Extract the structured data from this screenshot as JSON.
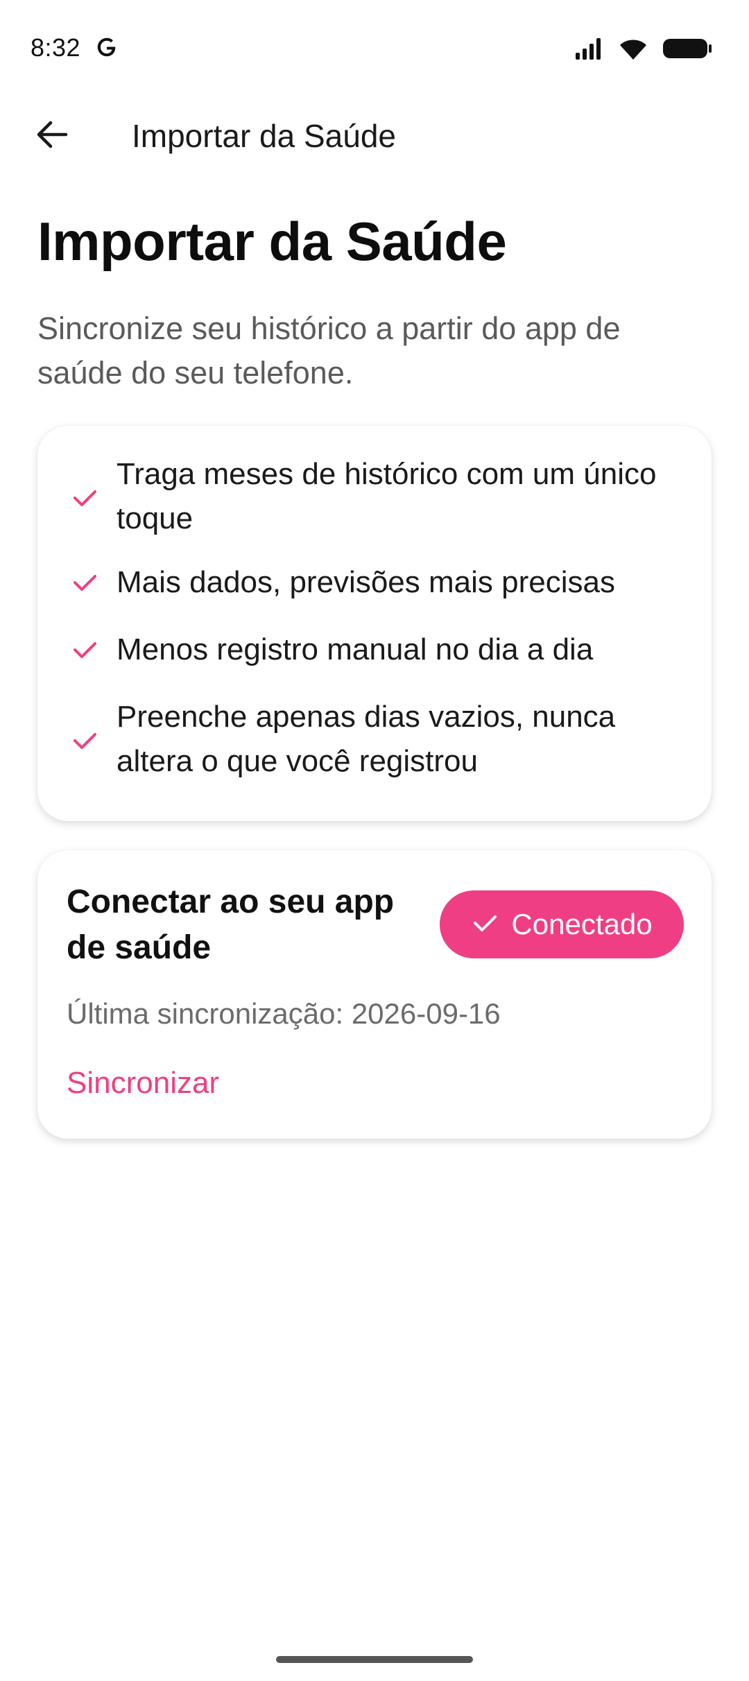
{
  "status_bar": {
    "time": "8:32",
    "icons": [
      "google-icon",
      "signal-icon",
      "wifi-icon",
      "battery-icon"
    ]
  },
  "app_bar": {
    "back_icon": "arrow-back-icon",
    "title": "Importar da Saúde"
  },
  "header": {
    "title": "Importar da Saúde",
    "subtitle": "Sincronize seu histórico a partir do app de saúde do seu telefone."
  },
  "benefits": {
    "icon": "check-icon",
    "items": [
      {
        "text": "Traga meses de histórico com um único toque"
      },
      {
        "text": "Mais dados, previsões mais precisas"
      },
      {
        "text": "Menos registro manual no dia a dia"
      },
      {
        "text": "Preenche apenas dias vazios, nunca altera o que você registrou"
      }
    ]
  },
  "connect": {
    "title": "Conectar ao seu app de saúde",
    "status_button_label": "Conectado",
    "last_sync": "Última sincronização: 2026-09-16",
    "sync_link": "Sincronizar"
  },
  "colors": {
    "accent": "#f03e84",
    "text_primary": "#111111",
    "text_secondary": "#5a5a5a",
    "card_background": "#ffffff"
  }
}
